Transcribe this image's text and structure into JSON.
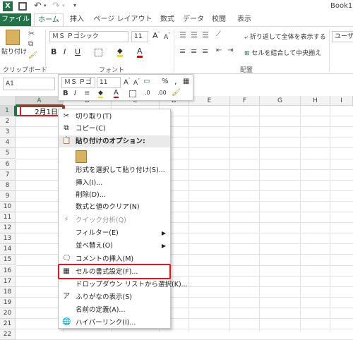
{
  "window": {
    "title": "Book1"
  },
  "tabs": [
    "ファイル",
    "ホーム",
    "挿入",
    "ページ レイアウト",
    "数式",
    "データ",
    "校閲",
    "表示"
  ],
  "ribbon": {
    "paste_label": "貼り付け",
    "clipboard_label": "クリップボード",
    "font_name": "ＭＳ Ｐゴシック",
    "font_size": "11",
    "font_group_label": "フォント",
    "wrap_text": "折り返して全体を表示する",
    "merge_center": "セルを結合して中央揃え",
    "alignment_label": "配置",
    "user_def": "ユーザー定"
  },
  "formula_bar": {
    "name_box": "A1",
    "fx": "fx"
  },
  "columns": [
    "A",
    "B",
    "C",
    "D",
    "E",
    "F",
    "G",
    "H",
    "I"
  ],
  "rows": [
    "1",
    "2",
    "3",
    "4",
    "5",
    "6",
    "7",
    "8",
    "9",
    "10",
    "11",
    "12",
    "13",
    "14",
    "15",
    "16",
    "17",
    "18",
    "19",
    "20",
    "21",
    "22"
  ],
  "cell_a1": "2月1日",
  "mini_toolbar": {
    "font_name": "ＭＳ Ｐゴ",
    "font_size": "11",
    "percent": "%",
    "comma": ","
  },
  "context_menu": {
    "cut": "切り取り(T)",
    "copy": "コピー(C)",
    "paste_options": "貼り付けのオプション:",
    "paste_special": "形式を選択して貼り付け(S)...",
    "insert": "挿入(I)...",
    "delete": "削除(D)...",
    "clear": "数式と値のクリア(N)",
    "quick_analysis": "クイック分析(Q)",
    "filter": "フィルター(E)",
    "sort": "並べ替え(O)",
    "insert_comment": "コメントの挿入(M)",
    "format_cells": "セルの書式設定(F)...",
    "dropdown_pick": "ドロップダウン リストから選択(K)...",
    "phonetic": "ふりがなの表示(S)",
    "define_name": "名前の定義(A)...",
    "hyperlink": "ハイパーリンク(I)..."
  },
  "colors": {
    "excel_green": "#217346",
    "highlight_red": "#e8141c"
  }
}
